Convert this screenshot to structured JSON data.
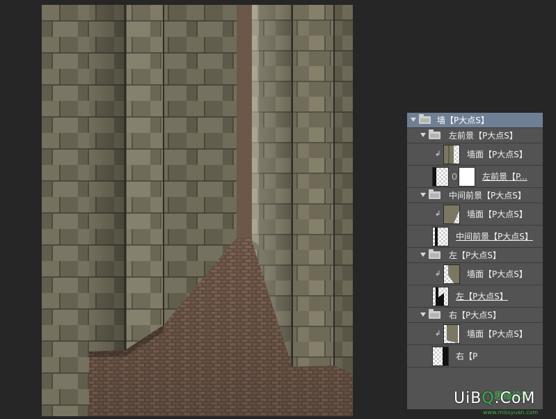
{
  "canvas": {
    "description_icon": "image-canvas"
  },
  "layers_panel": {
    "rows": [
      {
        "kind": "group",
        "label": "墙【P大点S】",
        "indent": 0,
        "selected": true
      },
      {
        "kind": "group",
        "label": "左前景【P大点S】",
        "indent": 1
      },
      {
        "kind": "clipped",
        "label": "墙面【P大点S】",
        "thumb": "wall-left"
      },
      {
        "kind": "masked",
        "label": "左前景【P...",
        "thumb": "shape-left-fg",
        "underline": true
      },
      {
        "kind": "group",
        "label": "中间前景【P大点S】",
        "indent": 1
      },
      {
        "kind": "clipped",
        "label": "墙面【P大点S】",
        "thumb": "wall-mid"
      },
      {
        "kind": "shape",
        "label": "中间前景【P大点S】",
        "thumb": "shape-mid",
        "underline": true
      },
      {
        "kind": "group",
        "label": "左【P大点S】",
        "indent": 1
      },
      {
        "kind": "clipped",
        "label": "墙面【P大点S】",
        "thumb": "wall-left2"
      },
      {
        "kind": "shape",
        "label": "左【P大点S】",
        "thumb": "shape-left",
        "underline": true
      },
      {
        "kind": "group",
        "label": "右【P大点S】",
        "indent": 1
      },
      {
        "kind": "clipped",
        "label": "墙面【P大点S】",
        "thumb": "wall-right"
      },
      {
        "kind": "shape",
        "label": "右【P",
        "thumb": "shape-right",
        "underline": false
      }
    ]
  },
  "watermark": {
    "main_a": "UiB",
    "main_o": "Q",
    "main_b": ".CoM",
    "sub": "思缘论坛",
    "url": "www.missyuan.com"
  }
}
